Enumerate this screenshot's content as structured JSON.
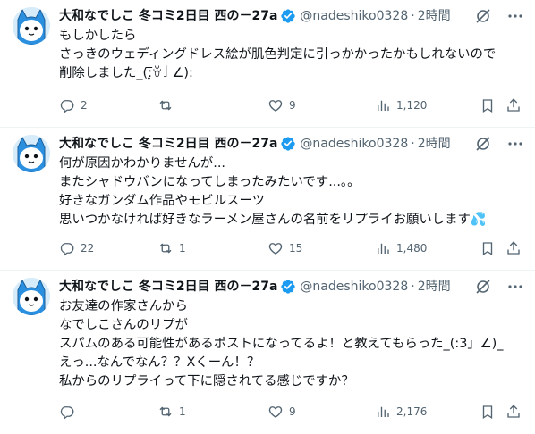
{
  "tweets": [
    {
      "display_name": "大和なでしこ 冬コミ2日目 西の－27a",
      "handle": "@nadeshiko0328",
      "separator": "·",
      "time": "2時間",
      "lines": [
        "もしかしたら",
        "さっきのウェディングドレス絵が肌色判定に引っかかったかもしれないので",
        "削除しました_(:̥̅ꈊ」∠):"
      ],
      "replies": "2",
      "retweets": "",
      "likes": "9",
      "views": "1,120"
    },
    {
      "display_name": "大和なでしこ 冬コミ2日目 西の－27a",
      "handle": "@nadeshiko0328",
      "separator": "·",
      "time": "2時間",
      "lines": [
        "何が原因かわかりませんが...",
        "またシャドウバンになってしまったみたいです...。。",
        "好きなガンダム作品やモビルスーツ",
        "思いつかなければ好きなラーメン屋さんの名前をリプライお願いします💦"
      ],
      "replies": "22",
      "retweets": "1",
      "likes": "15",
      "views": "1,480"
    },
    {
      "display_name": "大和なでしこ 冬コミ2日目 西の－27a",
      "handle": "@nadeshiko0328",
      "separator": "·",
      "time": "2時間",
      "lines": [
        "お友達の作家さんから",
        "なでしこさんのリプが",
        "スパムのある可能性があるポストになってるよ！と教えてもらった_(:3」∠)_",
        "えっ...なんでなん？？Xくーん！？",
        "私からのリプライって下に隠されてる感じですか？"
      ],
      "replies": "",
      "retweets": "1",
      "likes": "9",
      "views": "2,176"
    }
  ],
  "icons": {
    "avatar": "blue-cat-avatar-icon",
    "verified": "verified-badge-icon",
    "grok": "grok-icon",
    "more": "more-icon",
    "reply": "reply-icon",
    "retweet": "retweet-icon",
    "like": "heart-icon",
    "views": "views-icon",
    "bookmark": "bookmark-icon",
    "share": "share-icon"
  },
  "colors": {
    "verified": "#1d9bf0",
    "secondary_text": "#536471",
    "divider": "#eff3f4"
  }
}
